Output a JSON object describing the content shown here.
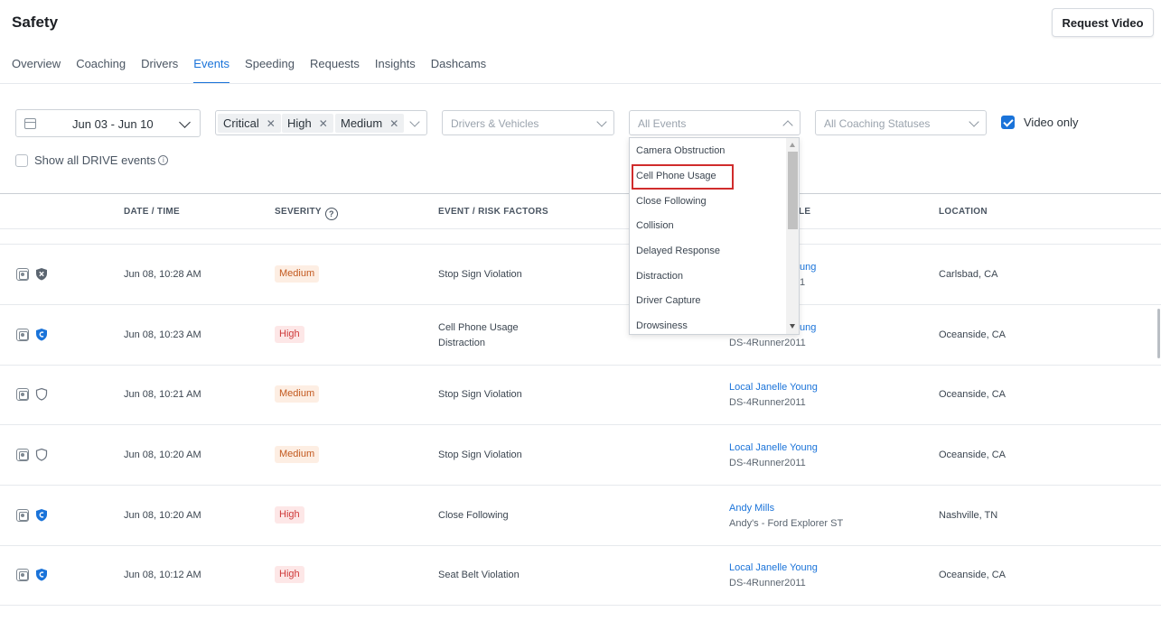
{
  "header": {
    "title": "Safety",
    "request_video": "Request Video"
  },
  "tabs": [
    {
      "label": "Overview",
      "active": false
    },
    {
      "label": "Coaching",
      "active": false
    },
    {
      "label": "Drivers",
      "active": false
    },
    {
      "label": "Events",
      "active": true
    },
    {
      "label": "Speeding",
      "active": false
    },
    {
      "label": "Requests",
      "active": false
    },
    {
      "label": "Insights",
      "active": false
    },
    {
      "label": "Dashcams",
      "active": false
    }
  ],
  "filters": {
    "date_range": "Jun 03 - Jun 10",
    "severity_chips": [
      "Critical",
      "High",
      "Medium"
    ],
    "drivers_placeholder": "Drivers & Vehicles",
    "events_placeholder": "All Events",
    "coaching_placeholder": "All Coaching Statuses",
    "video_only_label": "Video only",
    "video_only_checked": true,
    "show_all_label": "Show all DRIVE events",
    "show_all_checked": false
  },
  "table": {
    "columns": {
      "datetime": "DATE / TIME",
      "severity": "SEVERITY",
      "event": "EVENT / RISK FACTORS",
      "vehicle_partial": "LE",
      "location": "LOCATION"
    },
    "rows": [
      {
        "datetime": "Jun 08, 10:28 AM",
        "severity": "Medium",
        "event_lines": [
          "Stop Sign Violation"
        ],
        "driver": "ung",
        "vehicle": "1",
        "location": "Carlsbad, CA",
        "shield": "dark-x"
      },
      {
        "datetime": "Jun 08, 10:23 AM",
        "severity": "High",
        "event_lines": [
          "Cell Phone Usage",
          "Distraction"
        ],
        "driver": "ung",
        "vehicle": "DS-4Runner2011",
        "location": "Oceanside, CA",
        "shield": "blue"
      },
      {
        "datetime": "Jun 08, 10:21 AM",
        "severity": "Medium",
        "event_lines": [
          "Stop Sign Violation"
        ],
        "driver": "Local Janelle Young",
        "vehicle": "DS-4Runner2011",
        "location": "Oceanside, CA",
        "shield": "outline"
      },
      {
        "datetime": "Jun 08, 10:20 AM",
        "severity": "Medium",
        "event_lines": [
          "Stop Sign Violation"
        ],
        "driver": "Local Janelle Young",
        "vehicle": "DS-4Runner2011",
        "location": "Oceanside, CA",
        "shield": "outline"
      },
      {
        "datetime": "Jun 08, 10:20 AM",
        "severity": "High",
        "event_lines": [
          "Close Following"
        ],
        "driver": "Andy Mills",
        "vehicle": "Andy's - Ford Explorer ST",
        "location": "Nashville, TN",
        "shield": "blue"
      },
      {
        "datetime": "Jun 08, 10:12 AM",
        "severity": "High",
        "event_lines": [
          "Seat Belt Violation"
        ],
        "driver": "Local Janelle Young",
        "vehicle": "DS-4Runner2011",
        "location": "Oceanside, CA",
        "shield": "blue"
      }
    ]
  },
  "events_dropdown": {
    "items": [
      "Camera Obstruction",
      "Cell Phone Usage",
      "Close Following",
      "Collision",
      "Delayed Response",
      "Distraction",
      "Driver Capture",
      "Drowsiness"
    ],
    "highlighted": "Cell Phone Usage"
  },
  "colors": {
    "accent": "#1a73d9",
    "highlight_border": "#d02c2c",
    "medium": "#c3591f",
    "high": "#cf3a3a"
  }
}
